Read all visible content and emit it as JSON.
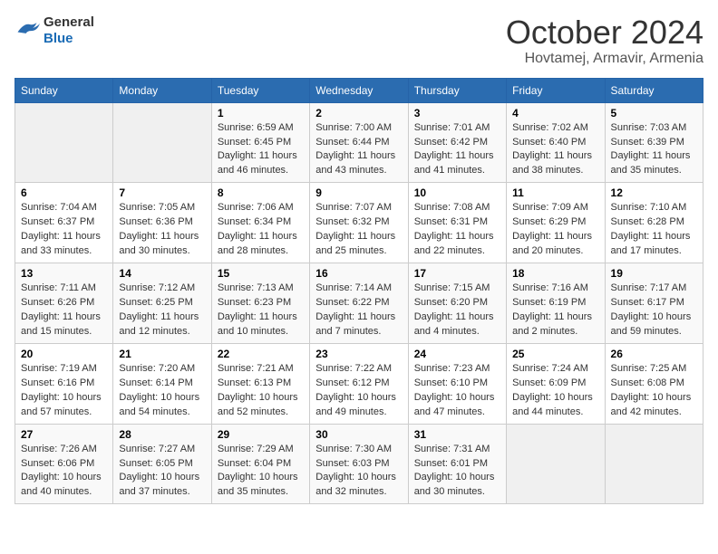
{
  "header": {
    "logo_general": "General",
    "logo_blue": "Blue",
    "month": "October 2024",
    "location": "Hovtamej, Armavir, Armenia"
  },
  "days_of_week": [
    "Sunday",
    "Monday",
    "Tuesday",
    "Wednesday",
    "Thursday",
    "Friday",
    "Saturday"
  ],
  "weeks": [
    [
      {
        "day": "",
        "content": ""
      },
      {
        "day": "",
        "content": ""
      },
      {
        "day": "1",
        "content": "Sunrise: 6:59 AM\nSunset: 6:45 PM\nDaylight: 11 hours and 46 minutes."
      },
      {
        "day": "2",
        "content": "Sunrise: 7:00 AM\nSunset: 6:44 PM\nDaylight: 11 hours and 43 minutes."
      },
      {
        "day": "3",
        "content": "Sunrise: 7:01 AM\nSunset: 6:42 PM\nDaylight: 11 hours and 41 minutes."
      },
      {
        "day": "4",
        "content": "Sunrise: 7:02 AM\nSunset: 6:40 PM\nDaylight: 11 hours and 38 minutes."
      },
      {
        "day": "5",
        "content": "Sunrise: 7:03 AM\nSunset: 6:39 PM\nDaylight: 11 hours and 35 minutes."
      }
    ],
    [
      {
        "day": "6",
        "content": "Sunrise: 7:04 AM\nSunset: 6:37 PM\nDaylight: 11 hours and 33 minutes."
      },
      {
        "day": "7",
        "content": "Sunrise: 7:05 AM\nSunset: 6:36 PM\nDaylight: 11 hours and 30 minutes."
      },
      {
        "day": "8",
        "content": "Sunrise: 7:06 AM\nSunset: 6:34 PM\nDaylight: 11 hours and 28 minutes."
      },
      {
        "day": "9",
        "content": "Sunrise: 7:07 AM\nSunset: 6:32 PM\nDaylight: 11 hours and 25 minutes."
      },
      {
        "day": "10",
        "content": "Sunrise: 7:08 AM\nSunset: 6:31 PM\nDaylight: 11 hours and 22 minutes."
      },
      {
        "day": "11",
        "content": "Sunrise: 7:09 AM\nSunset: 6:29 PM\nDaylight: 11 hours and 20 minutes."
      },
      {
        "day": "12",
        "content": "Sunrise: 7:10 AM\nSunset: 6:28 PM\nDaylight: 11 hours and 17 minutes."
      }
    ],
    [
      {
        "day": "13",
        "content": "Sunrise: 7:11 AM\nSunset: 6:26 PM\nDaylight: 11 hours and 15 minutes."
      },
      {
        "day": "14",
        "content": "Sunrise: 7:12 AM\nSunset: 6:25 PM\nDaylight: 11 hours and 12 minutes."
      },
      {
        "day": "15",
        "content": "Sunrise: 7:13 AM\nSunset: 6:23 PM\nDaylight: 11 hours and 10 minutes."
      },
      {
        "day": "16",
        "content": "Sunrise: 7:14 AM\nSunset: 6:22 PM\nDaylight: 11 hours and 7 minutes."
      },
      {
        "day": "17",
        "content": "Sunrise: 7:15 AM\nSunset: 6:20 PM\nDaylight: 11 hours and 4 minutes."
      },
      {
        "day": "18",
        "content": "Sunrise: 7:16 AM\nSunset: 6:19 PM\nDaylight: 11 hours and 2 minutes."
      },
      {
        "day": "19",
        "content": "Sunrise: 7:17 AM\nSunset: 6:17 PM\nDaylight: 10 hours and 59 minutes."
      }
    ],
    [
      {
        "day": "20",
        "content": "Sunrise: 7:19 AM\nSunset: 6:16 PM\nDaylight: 10 hours and 57 minutes."
      },
      {
        "day": "21",
        "content": "Sunrise: 7:20 AM\nSunset: 6:14 PM\nDaylight: 10 hours and 54 minutes."
      },
      {
        "day": "22",
        "content": "Sunrise: 7:21 AM\nSunset: 6:13 PM\nDaylight: 10 hours and 52 minutes."
      },
      {
        "day": "23",
        "content": "Sunrise: 7:22 AM\nSunset: 6:12 PM\nDaylight: 10 hours and 49 minutes."
      },
      {
        "day": "24",
        "content": "Sunrise: 7:23 AM\nSunset: 6:10 PM\nDaylight: 10 hours and 47 minutes."
      },
      {
        "day": "25",
        "content": "Sunrise: 7:24 AM\nSunset: 6:09 PM\nDaylight: 10 hours and 44 minutes."
      },
      {
        "day": "26",
        "content": "Sunrise: 7:25 AM\nSunset: 6:08 PM\nDaylight: 10 hours and 42 minutes."
      }
    ],
    [
      {
        "day": "27",
        "content": "Sunrise: 7:26 AM\nSunset: 6:06 PM\nDaylight: 10 hours and 40 minutes."
      },
      {
        "day": "28",
        "content": "Sunrise: 7:27 AM\nSunset: 6:05 PM\nDaylight: 10 hours and 37 minutes."
      },
      {
        "day": "29",
        "content": "Sunrise: 7:29 AM\nSunset: 6:04 PM\nDaylight: 10 hours and 35 minutes."
      },
      {
        "day": "30",
        "content": "Sunrise: 7:30 AM\nSunset: 6:03 PM\nDaylight: 10 hours and 32 minutes."
      },
      {
        "day": "31",
        "content": "Sunrise: 7:31 AM\nSunset: 6:01 PM\nDaylight: 10 hours and 30 minutes."
      },
      {
        "day": "",
        "content": ""
      },
      {
        "day": "",
        "content": ""
      }
    ]
  ]
}
